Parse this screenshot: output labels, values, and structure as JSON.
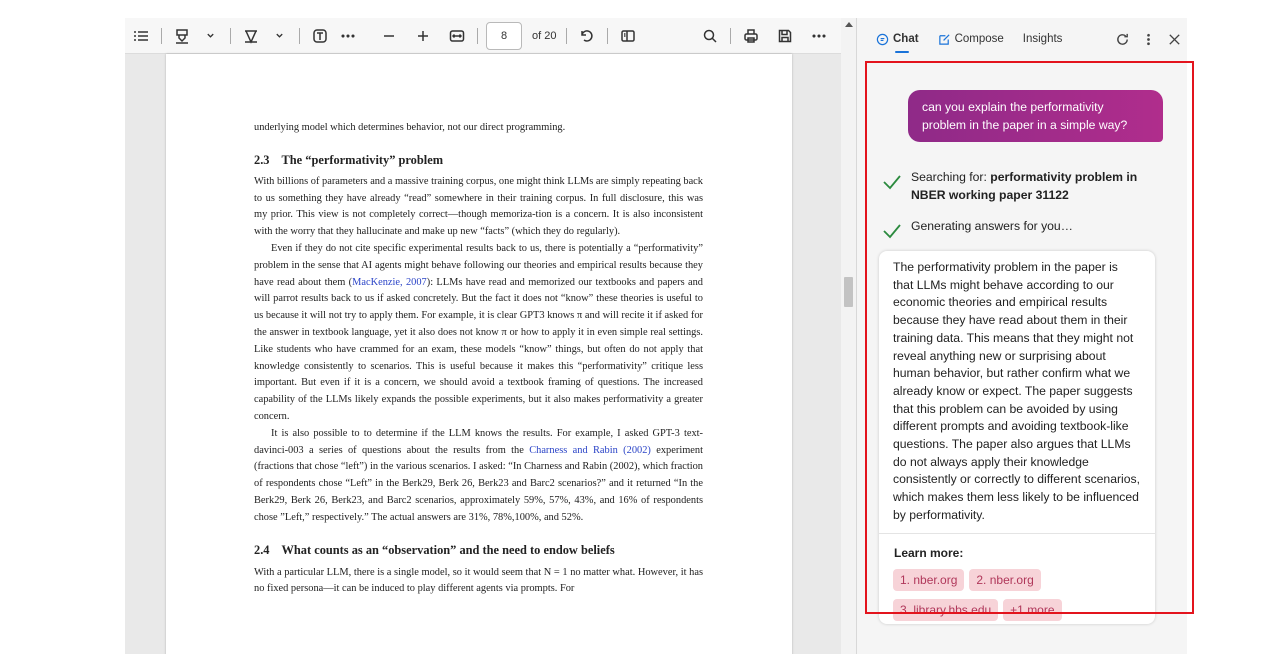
{
  "toolbar": {
    "page_number": "8",
    "page_of": "of 20",
    "icons": [
      "table-of-contents-icon",
      "highlight-icon",
      "chevron-down-icon",
      "draw-icon",
      "chevron-down-icon",
      "text-box-icon",
      "more-options-icon",
      "zoom-out-icon",
      "zoom-in-icon",
      "fit-page-icon",
      "rotate-icon",
      "page-view-icon",
      "search-icon",
      "print-icon",
      "save-icon",
      "more-icon"
    ]
  },
  "pdf": {
    "line_top": "underlying model which determines behavior, not our direct programming.",
    "section_23": {
      "number": "2.3",
      "title": "The “performativity” problem"
    },
    "para1": "With billions of parameters and a massive training corpus, one might think LLMs are simply repeating back to us something they have already “read” somewhere in their training corpus. In full disclosure, this was my prior. This view is not completely correct—though memoriza-tion is a concern. It is also inconsistent with the worry that they hallucinate and make up new “facts” (which they do regularly).",
    "para2_a": "Even if they do not cite specific experimental results back to us, there is potentially a “performativity” problem in the sense that AI agents might behave following our theories and empirical results because they have read about them (",
    "para2_cite": "MacKenzie, 2007",
    "para2_b": "): LLMs have read and memorized our textbooks and papers and will parrot results back to us if asked concretely. But the fact it does not “know” these theories is useful to us because it will not try to apply them. For example, it is clear GPT3 knows π and will recite it if asked for the answer in textbook language, yet it also does not know π or how to apply it in even simple real settings. Like students who have crammed for an exam, these models “know” things, but often do not apply that knowledge consistently to scenarios. This is useful because it makes this “performativity” critique less important. But even if it is a concern, we should avoid a textbook framing of questions. The increased capability of the LLMs likely expands the possible experiments, but it also makes performativity a greater concern.",
    "para3_a": "It is also possible to to determine if the LLM knows the results. For example, I asked GPT-3 text-davinci-003 a series of questions about the results from the ",
    "para3_cite": "Charness and Rabin (2002)",
    "para3_b": " experiment (fractions that chose “left”) in the various scenarios. I asked: “In Charness and Rabin (2002), which fraction of respondents chose “Left” in the Berk29, Berk 26, Berk23 and Barc2 scenarios?”  and it returned “In the Berk29, Berk 26, Berk23, and Barc2 scenarios, approximately 59%, 57%, 43%, and 16% of respondents chose ”Left,” respectively.”  The actual answers are 31%, 78%,100%, and 52%.",
    "section_24": {
      "number": "2.4",
      "title": "What counts as an “observation” and the need to endow beliefs"
    },
    "para4": "With a particular LLM, there is a single model, so it would seem that N = 1 no matter what. However, it has no fixed persona—it can be induced to play different agents via prompts. For"
  },
  "panel": {
    "tabs": [
      {
        "label": "Chat",
        "icon": "chat-icon"
      },
      {
        "label": "Compose",
        "icon": "compose-icon"
      },
      {
        "label": "Insights",
        "icon": ""
      }
    ],
    "user_message": "can you explain the performativity problem in the paper in a simple way?",
    "search_prefix": "Searching for: ",
    "search_query": "performativity problem in NBER working paper 31122",
    "generating": "Generating answers for you…",
    "answer": "The performativity problem in the paper is that LLMs might behave according to our economic theories and empirical results because they have read about them in their training data. This means that they might not reveal anything new or surprising about human behavior, but rather confirm what we already know or expect. The paper suggests that this problem can be avoided by using different prompts and avoiding textbook-like questions. The paper also argues that LLMs do not always apply their knowledge consistently or correctly to different scenarios, which makes them less likely to be influenced by performativity.",
    "learn_more_label": "Learn more:",
    "sources": [
      "1. nber.org",
      "2. nber.org",
      "3. library.hbs.edu",
      "+1 more"
    ],
    "accent_color": "#1a73d9",
    "user_bubble_color": "#a02c8a",
    "highlight_color": "#e3141d"
  }
}
